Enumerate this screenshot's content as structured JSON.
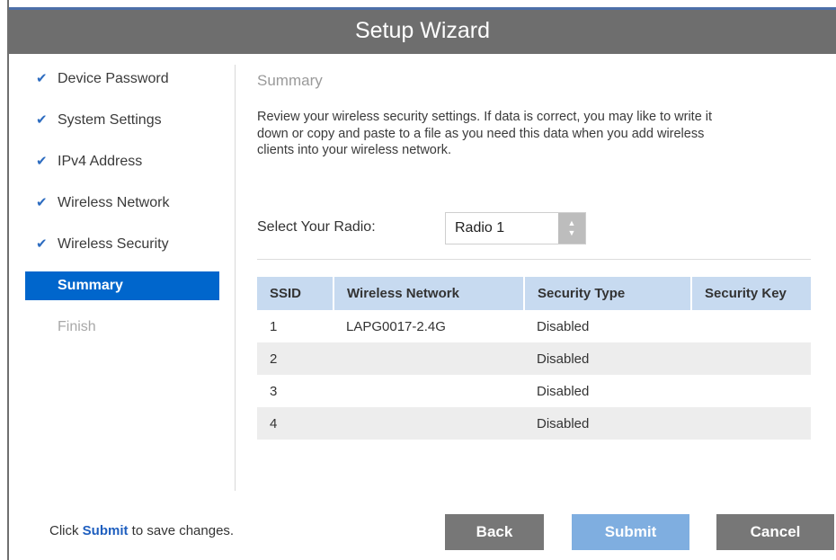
{
  "window": {
    "title": "Setup Wizard"
  },
  "steps": [
    {
      "label": "Device Password",
      "state": "done"
    },
    {
      "label": "System Settings",
      "state": "done"
    },
    {
      "label": "IPv4 Address",
      "state": "done"
    },
    {
      "label": "Wireless Network",
      "state": "done"
    },
    {
      "label": "Wireless Security",
      "state": "done"
    },
    {
      "label": "Summary",
      "state": "active"
    },
    {
      "label": "Finish",
      "state": "pending"
    }
  ],
  "check_glyph": "✔",
  "main": {
    "section_title": "Summary",
    "description": "Review your wireless security settings. If data is correct, you may like to write it down or copy and paste to a file as you need this data when you add wireless clients into your wireless network.",
    "radio_label": "Select Your Radio:",
    "radio_value": "Radio 1",
    "spinner_up": "▲",
    "spinner_down": "▼"
  },
  "table": {
    "headers": [
      "SSID",
      "Wireless Network",
      "Security Type",
      "Security Key"
    ],
    "rows": [
      [
        "1",
        "LAPG0017-2.4G",
        "Disabled",
        ""
      ],
      [
        "2",
        "",
        "Disabled",
        ""
      ],
      [
        "3",
        "",
        "Disabled",
        ""
      ],
      [
        "4",
        "",
        "Disabled",
        ""
      ]
    ]
  },
  "footer": {
    "prefix": "Click ",
    "link": "Submit",
    "suffix": " to save changes."
  },
  "buttons": {
    "back": "Back",
    "submit": "Submit",
    "cancel": "Cancel"
  },
  "colors": {
    "title_bar": "#6e6e6e",
    "active_step": "#0066cc",
    "check": "#2d6cc0",
    "table_header": "#c7daf0",
    "submit_button": "#7faee0",
    "secondary_button": "#777777"
  }
}
